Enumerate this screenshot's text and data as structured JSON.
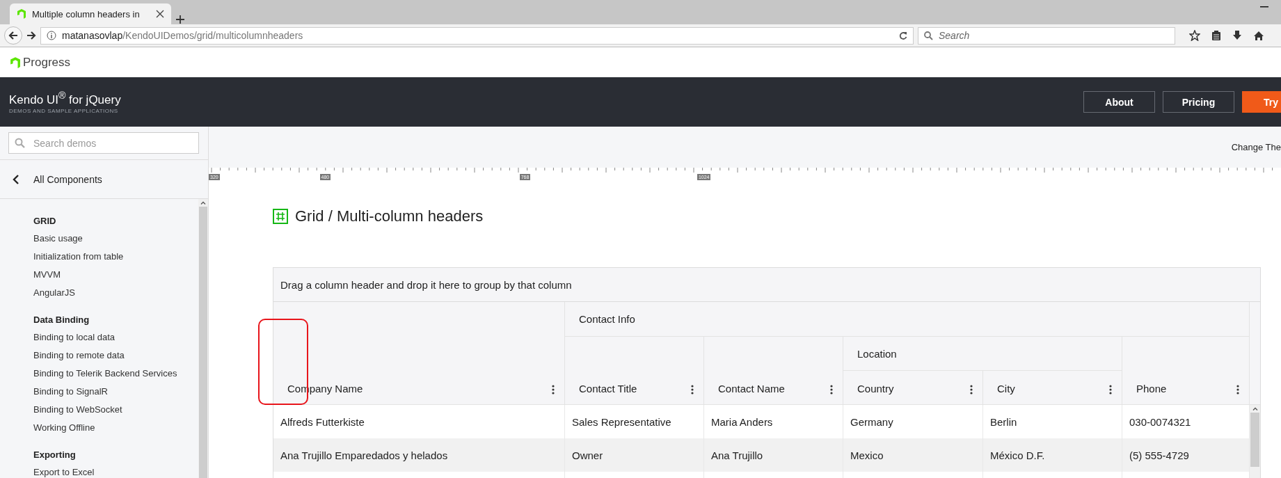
{
  "browser": {
    "tab": {
      "title": "Multiple column headers in"
    },
    "address": {
      "host": "matanasovlap",
      "path": "/KendoUIDemos/grid/multicolumnheaders"
    },
    "search": {
      "placeholder": "Search"
    }
  },
  "site_header": {
    "logo": "Progress",
    "product": "Kendo UI$^{®}$ for jQuery",
    "tagline": "DEMOS AND SAMPLE APPLICATIONS",
    "buttons": [
      {
        "label": "About",
        "kind": "outline"
      },
      {
        "label": "Pricing",
        "kind": "outline"
      },
      {
        "label": "Try",
        "kind": "primary"
      }
    ]
  },
  "sidebar": {
    "search": {
      "placeholder": "Search demos"
    },
    "back": "All Components",
    "sections": [
      {
        "title": "GRID",
        "items": [
          "Basic usage",
          "Initialization from table",
          "MVVM",
          "AngularJS"
        ]
      },
      {
        "title": "Data Binding",
        "items": [
          "Binding to local data",
          "Binding to remote data",
          "Binding to Telerik Backend Services",
          "Binding to SignalR",
          "Binding to WebSocket",
          "Working Offline"
        ]
      },
      {
        "title": "Exporting",
        "items": [
          "Export to Excel"
        ]
      }
    ]
  },
  "toolbar": {
    "theme_link": "Change The"
  },
  "ruler": {
    "ticks": [
      "320",
      "480",
      "768",
      "1024"
    ]
  },
  "page_title": "Grid / Multi-column headers",
  "grid": {
    "group_panel": "Drag a column header and drop it here to group by that column",
    "headers": [
      {
        "title": "Company Name",
        "menu": true
      },
      {
        "title": "Contact Info",
        "children": [
          {
            "title": "Contact Title",
            "menu": true
          },
          {
            "title": "Contact Name",
            "menu": true
          },
          {
            "title": "Location",
            "children": [
              {
                "title": "Country",
                "menu": true
              },
              {
                "title": "City",
                "menu": true
              }
            ]
          },
          {
            "title": "Phone",
            "menu": true
          }
        ]
      }
    ],
    "rows": [
      {
        "cells": [
          "Alfreds Futterkiste",
          "Sales Representative",
          "Maria Anders",
          "Germany",
          "Berlin",
          "030-0074321"
        ],
        "alt": false
      },
      {
        "cells": [
          "Ana Trujillo Emparedados y helados",
          "Owner",
          "Ana Trujillo",
          "Mexico",
          "México D.F.",
          "(5) 555-4729"
        ],
        "alt": true
      }
    ]
  },
  "annotation": {
    "kind": "highlight",
    "color": "#e8151b"
  }
}
